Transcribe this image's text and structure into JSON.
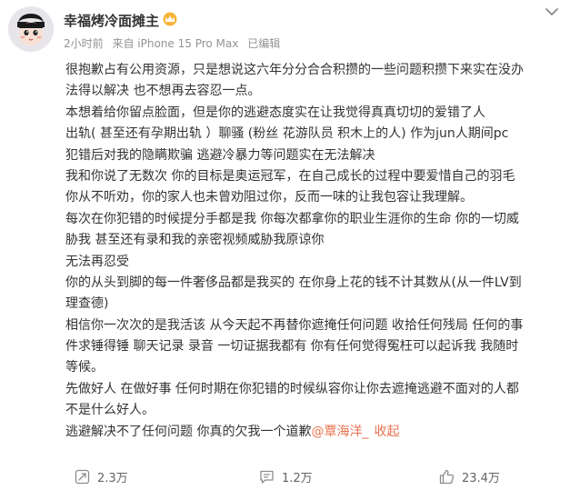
{
  "author": {
    "name": "幸福烤冷面摊主"
  },
  "meta": {
    "time": "2小时前",
    "source": "来自 iPhone 15 Pro Max",
    "edited": "已编辑"
  },
  "content": {
    "lines": [
      "很抱歉占有公用资源，只是想说这六年分分合合积攒的一些问题积攒下来实在没办",
      "法得以解决 也不想再去容忍一点。",
      "本想着给你留点脸面，但是你的逃避态度实在让我觉得真真切切的爱错了人",
      "出轨( 甚至还有孕期出轨 ）聊骚 (粉丝 花游队员 积木上的人)  作为jun人期间pc",
      "犯错后对我的隐瞒欺骗 逃避冷暴力等问题实在无法解决",
      "我和你说了无数次 你的目标是奥运冠军，在自己成长的过程中要爱惜自己的羽毛",
      "你从不听劝，你的家人也未曾劝阻过你，反而一味的让我包容让我理解。",
      "每次在你犯错的时候提分手都是我 你每次都拿你的职业生涯你的生命 你的一切威",
      "胁我 甚至还有录和我的亲密视频威胁我原谅你",
      "无法再忍受",
      " 你的从头到脚的每一件奢侈品都是我买的 在你身上花的钱不计其数从(从一件LV到",
      "理查德)",
      "相信你一次次的是我活该 从今天起不再替你遮掩任何问题 收拾任何残局 任何的事",
      "件求锤得锤  聊天记录 录音 一切证据我都有 你有任何觉得冤枉可以起诉我 我随时",
      "等候。",
      "先做好人 在做好事 任何时期在你犯错的时候纵容你让你去遮掩逃避不面对的人都",
      "不是什么好人。"
    ],
    "last_line_text": "逃避解决不了任何问题 你真的欠我一个道歉",
    "mention": "@覃海洋_",
    "collapse": "收起"
  },
  "actions": {
    "repost_count": "2.3万",
    "comment_count": "1.2万",
    "like_count": "23.4万"
  },
  "colors": {
    "accent": "#eb7350",
    "text": "#333333",
    "meta": "#939393"
  },
  "icons": {
    "crown": "crown-icon",
    "menu": "chevron-down-icon",
    "repost": "repost-icon",
    "comment": "comment-icon",
    "like": "thumbs-up-icon"
  }
}
